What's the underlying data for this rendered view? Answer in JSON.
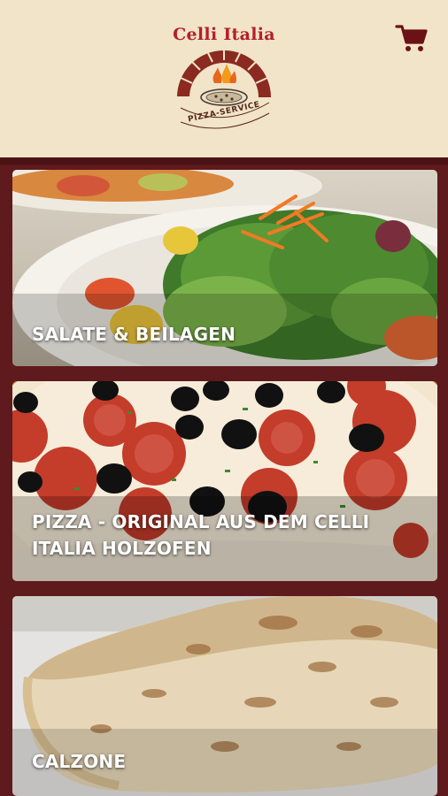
{
  "header": {
    "logo_title": "Celli Italia",
    "logo_subtitle": "PIZZA-SERVICE",
    "cart_icon": "shopping-cart-icon"
  },
  "categories": [
    {
      "label": "SALATE & BEILAGEN"
    },
    {
      "label": "PIZZA - ORIGINAL AUS DEM CELLI ITALIA HOLZOFEN"
    },
    {
      "label": "CALZONE"
    }
  ],
  "colors": {
    "header_bg": "#f1e4c8",
    "page_bg": "#5e1a1d",
    "brand_red": "#b3202a",
    "cart": "#6b1217"
  }
}
